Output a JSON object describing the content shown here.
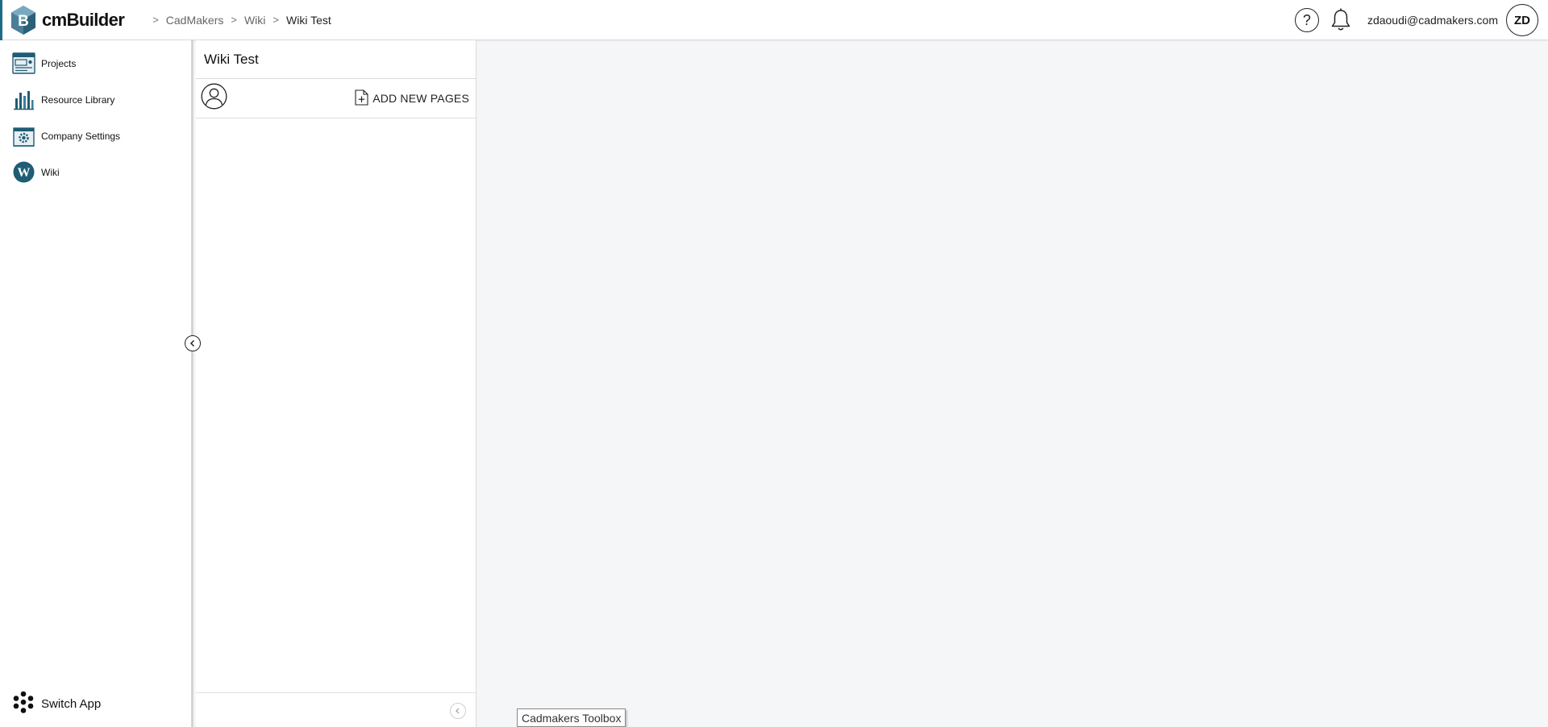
{
  "header": {
    "app_name": "cmBuilder",
    "logo_letter": "B",
    "breadcrumbs": [
      "CadMakers",
      "Wiki",
      "Wiki Test"
    ],
    "help_glyph": "?",
    "user_email": "zdaoudi@cadmakers.com",
    "avatar_initials": "ZD",
    "icons": [
      "help-icon",
      "bell-icon"
    ]
  },
  "sidebar": {
    "items": [
      {
        "label": "Projects",
        "icon": "projects-icon"
      },
      {
        "label": "Resource Library",
        "icon": "resource-library-icon"
      },
      {
        "label": "Company Settings",
        "icon": "company-settings-icon"
      },
      {
        "label": "Wiki",
        "icon": "wiki-icon"
      }
    ],
    "switch_app_label": "Switch App"
  },
  "wiki_panel": {
    "title": "Wiki Test",
    "add_pages_label": "ADD NEW PAGES"
  },
  "tooltip": {
    "text": "Cadmakers Toolbox"
  },
  "colors": {
    "accent": "#1f6b87",
    "content_bg": "#f5f6f8"
  }
}
